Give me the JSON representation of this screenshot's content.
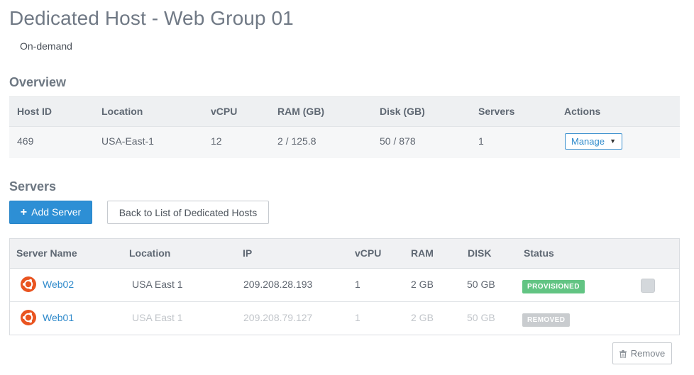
{
  "page": {
    "title": "Dedicated Host - Web Group 01",
    "billing": "On-demand"
  },
  "overview": {
    "heading": "Overview",
    "columns": [
      "Host ID",
      "Location",
      "vCPU",
      "RAM (GB)",
      "Disk (GB)",
      "Servers",
      "Actions"
    ],
    "row": {
      "host_id": "469",
      "location": "USA-East-1",
      "vcpu": "12",
      "ram": "2 / 125.8",
      "disk": "50 / 878",
      "servers": "1",
      "action_label": "Manage",
      "action_caret": "▼"
    }
  },
  "servers": {
    "heading": "Servers",
    "add_label": "Add Server",
    "add_icon": "plus-icon",
    "back_label": "Back to List of Dedicated Hosts",
    "columns": [
      "Server Name",
      "Location",
      "IP",
      "vCPU",
      "RAM",
      "DISK",
      "Status"
    ],
    "rows": [
      {
        "name": "Web02",
        "location": "USA East 1",
        "ip": "209.208.28.193",
        "vcpu": "1",
        "ram": "2 GB",
        "disk": "50 GB",
        "status": "PROVISIONED",
        "os_icon": "ubuntu-icon"
      },
      {
        "name": "Web01",
        "location": "USA East 1",
        "ip": "209.208.79.127",
        "vcpu": "1",
        "ram": "2 GB",
        "disk": "50 GB",
        "status": "REMOVED",
        "os_icon": "ubuntu-icon"
      }
    ],
    "remove_label": "Remove",
    "remove_icon": "trash-icon"
  },
  "colors": {
    "accent": "#2d8fd5",
    "provisioned": "#62c483",
    "removed": "#c9cccf",
    "ubuntu": "#e95420"
  }
}
